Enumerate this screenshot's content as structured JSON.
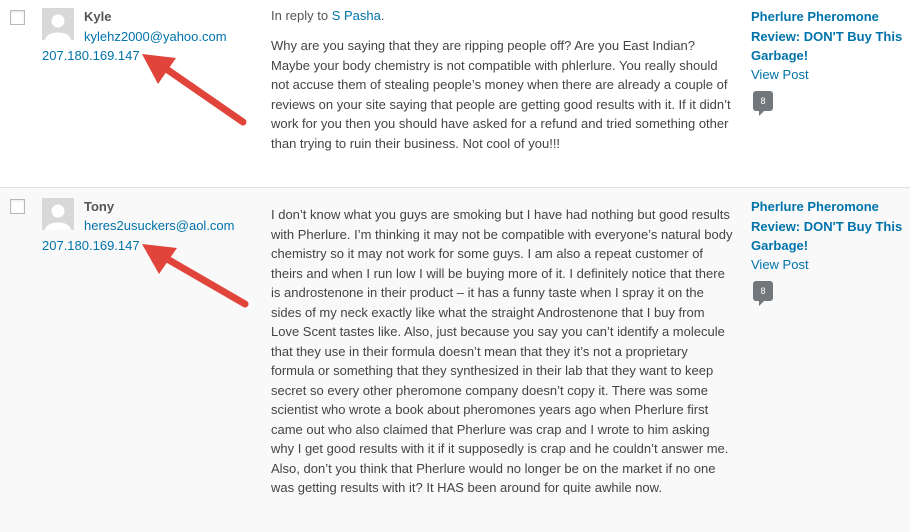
{
  "comments": [
    {
      "author_name": "Kyle",
      "author_email": "kylehz2000@yahoo.com",
      "author_ip": "207.180.169.147",
      "in_reply_prefix": "In reply to ",
      "in_reply_to": "S Pasha",
      "in_reply_suffix": ".",
      "text": "Why are you saying that they are ripping people off? Are you East Indian? Maybe your body chemistry is not compatible with phlerlure. You really should not accuse them of stealing people’s money when there are already a couple of reviews on your site saying that people are getting good results with it. If it didn’t work for you then you should have asked for a refund and tried something other than trying to ruin their business. Not cool of you!!!",
      "post_title": "Pherlure Pheromone Review: DON'T Buy This Garbage!",
      "view_post_label": "View Post",
      "comment_count": "8"
    },
    {
      "author_name": "Tony",
      "author_email": "heres2usuckers@aol.com",
      "author_ip": "207.180.169.147",
      "text": "I don’t know what you guys are smoking but I have had nothing but good results with Pherlure. I’m thinking it may not be compatible with everyone’s natural body chemistry so it may not work for some guys. I am also a repeat customer of theirs and when I run low I will be buying more of it. I definitely notice that there is androstenone in their product – it has a funny taste when I spray it on the sides of my neck exactly like what the straight Androstenone that I buy from Love Scent tastes like. Also, just because you say you can’t identify a molecule that they use in their formula doesn’t mean that they it’s not a proprietary formula or something that they synthesized in their lab that they want to keep secret so every other pheromone company doesn’t copy it. There was some scientist who wrote a book about pheromones years ago when Pherlure first came out who also claimed that Pherlure was crap and I wrote to him asking why I get good results with it if it supposedly is crap and he couldn’t answer me. Also, don’t you think that Pherlure would no longer be on the market if no one was getting results with it? It HAS been around for quite awhile now.",
      "post_title": "Pherlure Pheromone Review: DON'T Buy This Garbage!",
      "view_post_label": "View Post",
      "comment_count": "8"
    }
  ],
  "colors": {
    "link": "#0073aa",
    "annotation_arrow": "#e0443a"
  },
  "icons": {
    "avatar": "default-avatar-icon",
    "annotation": "red-arrow-icon"
  }
}
